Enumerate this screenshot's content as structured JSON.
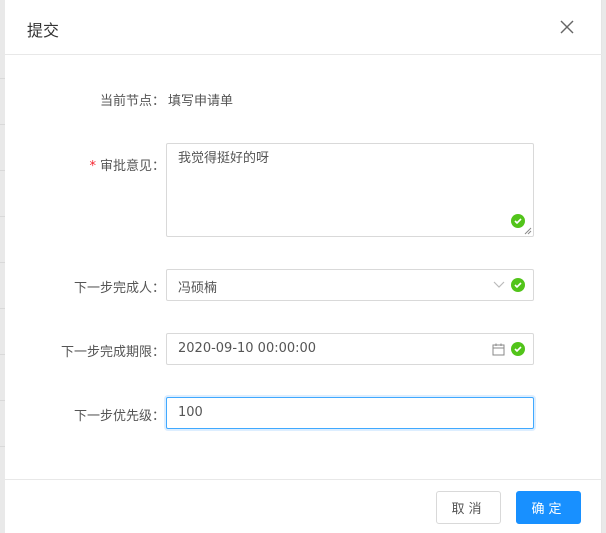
{
  "dialog": {
    "title": "提交",
    "close_label": "X"
  },
  "form": {
    "current_node_label": "当前节点：",
    "current_node_value": "填写申请单",
    "required_mark": "*",
    "opinion_label": "审批意见：",
    "opinion_value": "我觉得挺好的呀",
    "assignee_label": "下一步完成人：",
    "assignee_value": "冯硕楠",
    "deadline_label": "下一步完成期限：",
    "deadline_value": "2020-09-10 00:00:00",
    "priority_label": "下一步优先级：",
    "priority_value": "100"
  },
  "footer": {
    "cancel_label": "取消",
    "ok_label": "确定"
  },
  "colors": {
    "primary": "#1890ff",
    "success": "#52c41a",
    "required": "#f5222d"
  }
}
